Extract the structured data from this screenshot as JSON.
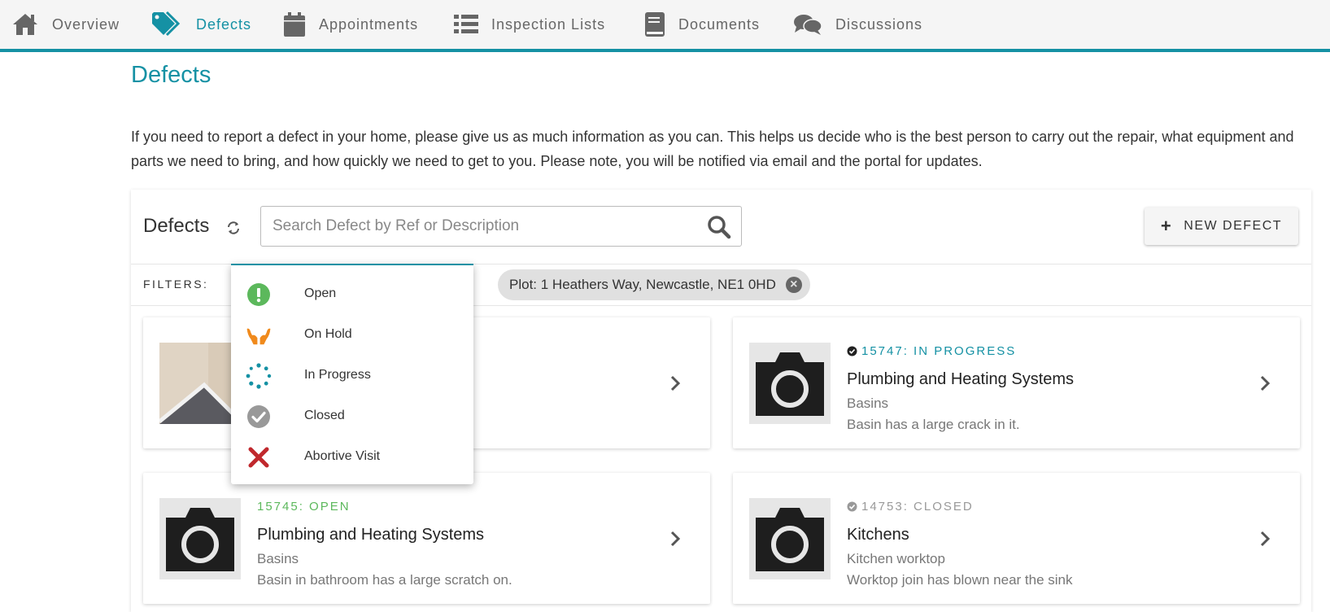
{
  "nav": {
    "items": [
      {
        "label": "Overview",
        "icon": "home-icon"
      },
      {
        "label": "Defects",
        "icon": "tag-icon",
        "active": true
      },
      {
        "label": "Appointments",
        "icon": "calendar-icon"
      },
      {
        "label": "Inspection Lists",
        "icon": "list-icon"
      },
      {
        "label": "Documents",
        "icon": "book-icon"
      },
      {
        "label": "Discussions",
        "icon": "comments-icon"
      }
    ]
  },
  "page": {
    "title": "Defects",
    "intro": "If you need to report a defect in your home, please give us as much information as you can. This helps us decide who is the best person to carry out the repair, what equipment and parts we need to bring, and how quickly we need to get to you. Please note, you will be notified via email and the portal for updates."
  },
  "panel": {
    "title": "Defects",
    "search_placeholder": "Search Defect by Ref or Description",
    "search_value": "",
    "new_button_label": "NEW DEFECT"
  },
  "filters": {
    "label": "FILTERS:",
    "chip": "Plot: 1 Heathers Way, Newcastle, NE1 0HD"
  },
  "status_dropdown": {
    "options": [
      {
        "label": "Open",
        "icon": "exclamation-circle-icon",
        "color": "#5cb85c"
      },
      {
        "label": "On Hold",
        "icon": "hands-icon",
        "color": "#f08a1c"
      },
      {
        "label": "In Progress",
        "icon": "spinner-icon",
        "color": "#1591a4"
      },
      {
        "label": "Closed",
        "icon": "check-circle-icon",
        "color": "#999999"
      },
      {
        "label": "Abortive Visit",
        "icon": "times-icon",
        "color": "#c0282d"
      }
    ]
  },
  "cards": [
    {
      "status": "",
      "category": "",
      "sub": "",
      "desc": "",
      "thumb": "photo"
    },
    {
      "status": "15747: IN PROGRESS",
      "status_color": "#1591a4",
      "category": "Plumbing and Heating Systems",
      "sub": "Basins",
      "desc": "Basin has a large crack in it.",
      "thumb": "camera"
    },
    {
      "status": "15745: OPEN",
      "status_color": "#5cb85c",
      "category": "Plumbing and Heating Systems",
      "sub": "Basins",
      "desc": "Basin in bathroom has a large scratch on.",
      "thumb": "camera"
    },
    {
      "status": "14753: CLOSED",
      "status_color": "#999999",
      "category": "Kitchens",
      "sub": "Kitchen worktop",
      "desc": "Worktop join has blown near the sink",
      "thumb": "camera"
    }
  ],
  "colors": {
    "accent": "#1591a4",
    "open": "#5cb85c",
    "closed": "#999999"
  }
}
